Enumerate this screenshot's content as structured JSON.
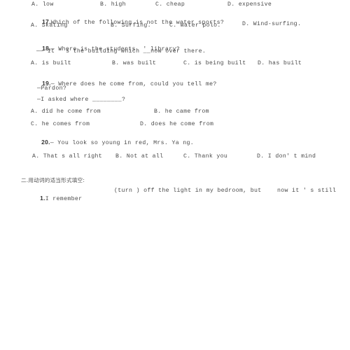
{
  "document": {
    "type": "scanned-worksheet",
    "page_background": "#ffffff",
    "text_color": "#4a4a4a"
  },
  "questions": [
    {
      "id": "q16-options",
      "options_row": {
        "a": "A. low",
        "b": "B. high",
        "c": "C. cheap",
        "d": "D. expensive"
      }
    },
    {
      "id": "q17",
      "number": "17.",
      "stem": "Which of the following is not the water sports?",
      "options_row": {
        "a": "A. Skating",
        "b": "B. Surfing.",
        "c": "C. Water polo.",
        "d": "D. Wind-surfing."
      }
    },
    {
      "id": "q18",
      "number": "18.",
      "stem_line1": "— Where is the students  ' library?",
      "stem_line2": "—— It ' s the building which __now over there.",
      "options_row": {
        "a": "A. is built",
        "b": "B. was built",
        "c": "C. is being built",
        "d": "D. has built"
      }
    },
    {
      "id": "q19",
      "number": "19.",
      "stem_line1": "— Where does he come from, could you tell me?",
      "stem_line2": "—Pardon?",
      "stem_line3": "—I asked where ________?",
      "options_row1": {
        "a": "A. did he come from",
        "b": "B. he came from"
      },
      "options_row2": {
        "c": "C. he comes from",
        "d": "D. does he come from"
      }
    },
    {
      "id": "q20",
      "number": "20.",
      "stem": "— You look so young in red, Mrs. Ya ng.",
      "options_row": {
        "a": "A. That s all right",
        "b": "B. Not at all",
        "c": "C. Thank you",
        "d": "D. I don' t mind"
      }
    }
  ],
  "section_two": {
    "heading": "二.用动词的适当形式填空:",
    "items": [
      {
        "number": "1.",
        "text_part1": "I remember",
        "text_part2": "(turn ) off the light in my bedroom, but",
        "text_part3": "now it ' s still"
      }
    ]
  }
}
